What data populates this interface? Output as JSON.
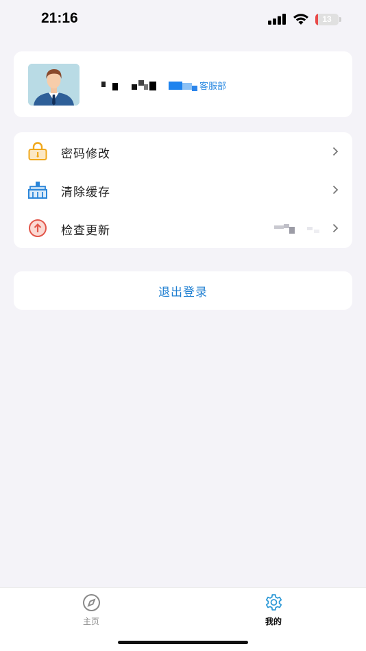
{
  "status_bar": {
    "time": "21:16",
    "battery_level": "13",
    "battery_percent": 13,
    "battery_color": "#e84a4a"
  },
  "profile": {
    "department": "客服部"
  },
  "menu": {
    "items": [
      {
        "label": "密码修改",
        "icon": "lock-icon",
        "color": "#f0a81c"
      },
      {
        "label": "清除缓存",
        "icon": "broom-icon",
        "color": "#2b86d9"
      },
      {
        "label": "检查更新",
        "icon": "upload-icon",
        "color": "#e2564a"
      }
    ]
  },
  "logout": {
    "label": "退出登录",
    "color": "#1f7fd1"
  },
  "tabbar": {
    "home_label": "主页",
    "mine_label": "我的",
    "active_color": "#2f9ad7",
    "inactive_color": "#888888"
  }
}
